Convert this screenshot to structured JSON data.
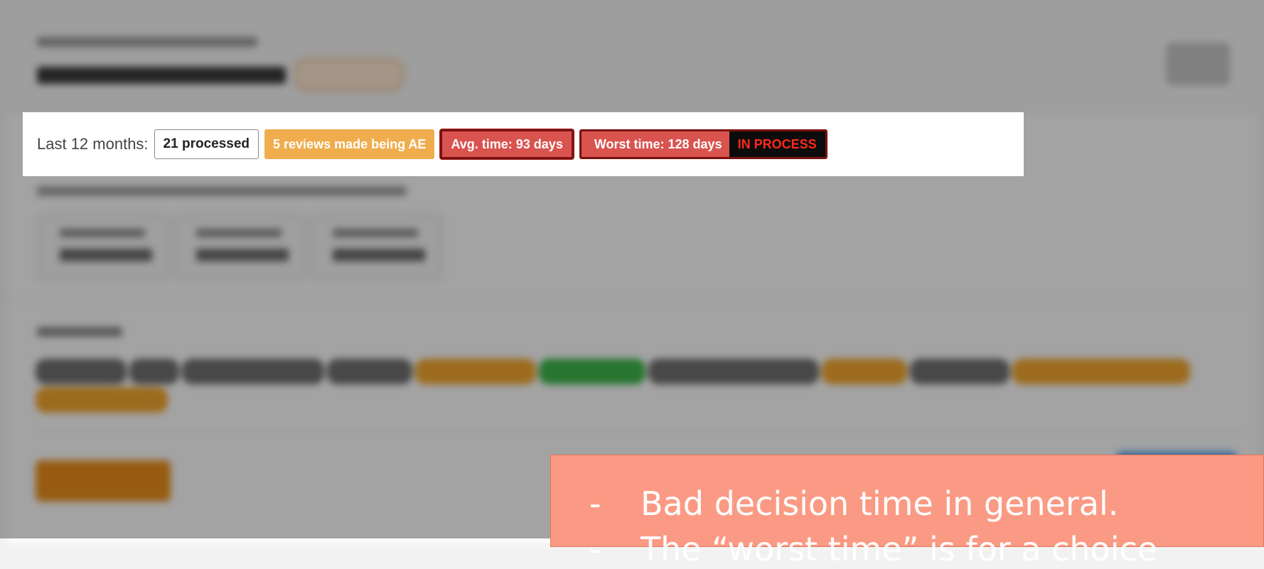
{
  "stats": {
    "label": "Last 12 months:",
    "processed": "21 processed",
    "reviews_ae": "5 reviews made being AE",
    "avg_time": "Avg. time: 93 days",
    "worst_time": "Worst time: 128 days",
    "worst_status": "IN PROCESS"
  },
  "note": {
    "bullet": "-",
    "items": [
      "Bad decision time in general.",
      "The “worst time” is for a choice"
    ]
  },
  "colors": {
    "warning": "#f0ad4e",
    "danger": "#d9534f",
    "danger_border": "#7a1212",
    "status_text": "#ff2a1a",
    "note_bg": "#fb9a84"
  }
}
